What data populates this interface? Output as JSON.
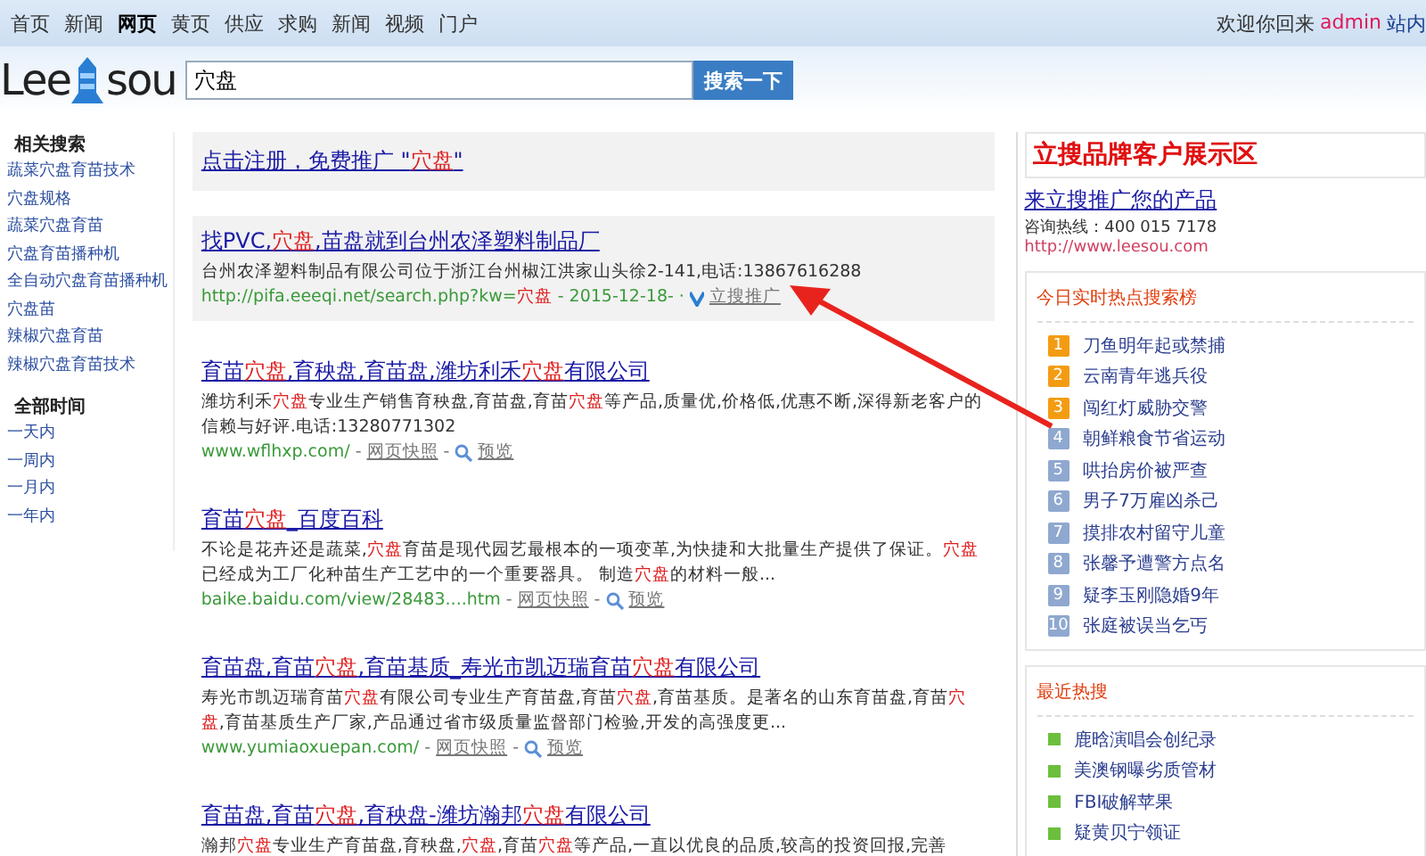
{
  "nav": {
    "items": [
      {
        "label": "首页",
        "selected": false
      },
      {
        "label": "新闻",
        "selected": false
      },
      {
        "label": "网页",
        "selected": true
      },
      {
        "label": "黄页",
        "selected": false
      },
      {
        "label": "供应",
        "selected": false
      },
      {
        "label": "求购",
        "selected": false
      },
      {
        "label": "新闻",
        "selected": false
      },
      {
        "label": "视频",
        "selected": false
      },
      {
        "label": "门户",
        "selected": false
      }
    ],
    "welcome": "欢迎你回来",
    "user": "admin",
    "site_link": "站内"
  },
  "logo": {
    "left": "Lee",
    "right": "sou"
  },
  "search": {
    "value": "穴盘",
    "button": "搜索一下"
  },
  "sidebar": [
    {
      "heading": "相关搜索",
      "items": [
        "蔬菜穴盘育苗技术",
        "穴盘规格",
        "蔬菜穴盘育苗",
        "穴盘育苗播种机",
        "全自动穴盘育苗播种机",
        "穴盘苗",
        "辣椒穴盘育苗",
        "辣椒穴盘育苗技术"
      ]
    },
    {
      "heading": "全部时间",
      "items": [
        "一天内",
        "一周内",
        "一月内",
        "一年内"
      ]
    }
  ],
  "promo": [
    {
      "t": "点击注册，免费推广 \"",
      "hl": false
    },
    {
      "t": "穴盘",
      "hl": true
    },
    {
      "t": "\"",
      "hl": false
    }
  ],
  "results": [
    {
      "sponsored": true,
      "title": [
        {
          "t": "找PVC,",
          "hl": false
        },
        {
          "t": "穴盘",
          "hl": true
        },
        {
          "t": ",苗盘就到台州农泽塑料制品厂",
          "hl": false
        }
      ],
      "desc": [
        {
          "t": "台州农泽塑料制品有限公司位于浙江台州椒江洪家山头徐2-141,电话:13867616288",
          "hl": false
        }
      ],
      "url": [
        {
          "t": "http://pifa.eeeqi.net/search.php?kw=",
          "hl": false
        },
        {
          "t": "穴盘",
          "hl": true
        },
        {
          "t": " - 2015-12-18- · ",
          "hl": false
        }
      ],
      "ad_label": "立搜推广"
    },
    {
      "sponsored": false,
      "title": [
        {
          "t": "育苗",
          "hl": false
        },
        {
          "t": "穴盘",
          "hl": true
        },
        {
          "t": ",育秧盘,育苗盘,潍坊利禾",
          "hl": false
        },
        {
          "t": "穴盘",
          "hl": true
        },
        {
          "t": "有限公司",
          "hl": false
        }
      ],
      "desc": [
        {
          "t": "潍坊利禾",
          "hl": false
        },
        {
          "t": "穴盘",
          "hl": true
        },
        {
          "t": "专业生产销售育秧盘,育苗盘,育苗",
          "hl": false
        },
        {
          "t": "穴盘",
          "hl": true
        },
        {
          "t": "等产品,质量优,价格低,优惠不断,深得新老客户的信赖与好评.电话:13280771302",
          "hl": false
        }
      ],
      "url": [
        {
          "t": "www.wflhxp.com/",
          "hl": false
        }
      ],
      "separator": "-",
      "snapshot": "网页快照",
      "preview": "预览"
    },
    {
      "sponsored": false,
      "title": [
        {
          "t": "育苗",
          "hl": false
        },
        {
          "t": "穴盘",
          "hl": true
        },
        {
          "t": "_百度百科",
          "hl": false
        }
      ],
      "desc": [
        {
          "t": "不论是花卉还是蔬菜,",
          "hl": false
        },
        {
          "t": "穴盘",
          "hl": true
        },
        {
          "t": "育苗是现代园艺最根本的一项变革,为快捷和大批量生产提供了保证。",
          "hl": false
        },
        {
          "t": "穴盘",
          "hl": true
        },
        {
          "t": "已经成为工厂化种苗生产工艺中的一个重要器具。 制造",
          "hl": false
        },
        {
          "t": "穴盘",
          "hl": true
        },
        {
          "t": "的材料一般...",
          "hl": false
        }
      ],
      "url": [
        {
          "t": "baike.baidu.com/view/28483....htm",
          "hl": false
        }
      ],
      "separator": "-",
      "snapshot": "网页快照",
      "preview": "预览"
    },
    {
      "sponsored": false,
      "title": [
        {
          "t": "育苗盘,育苗",
          "hl": false
        },
        {
          "t": "穴盘",
          "hl": true
        },
        {
          "t": ",育苗基质_寿光市凯迈瑞育苗",
          "hl": false
        },
        {
          "t": "穴盘",
          "hl": true
        },
        {
          "t": "有限公司",
          "hl": false
        }
      ],
      "desc": [
        {
          "t": "寿光市凯迈瑞育苗",
          "hl": false
        },
        {
          "t": "穴盘",
          "hl": true
        },
        {
          "t": "有限公司专业生产育苗盘,育苗",
          "hl": false
        },
        {
          "t": "穴盘",
          "hl": true
        },
        {
          "t": ",育苗基质。是著名的山东育苗盘,育苗",
          "hl": false
        },
        {
          "t": "穴盘",
          "hl": true
        },
        {
          "t": ",育苗基质生产厂家,产品通过省市级质量监督部门检验,开发的高强度更...",
          "hl": false
        }
      ],
      "url": [
        {
          "t": "www.yumiaoxuepan.com/",
          "hl": false
        }
      ],
      "separator": "-",
      "snapshot": "网页快照",
      "preview": "预览"
    },
    {
      "sponsored": false,
      "title": [
        {
          "t": "育苗盘,育苗",
          "hl": false
        },
        {
          "t": "穴盘",
          "hl": true
        },
        {
          "t": ",育秧盘-潍坊瀚邦",
          "hl": false
        },
        {
          "t": "穴盘",
          "hl": true
        },
        {
          "t": "有限公司",
          "hl": false
        }
      ],
      "desc": [
        {
          "t": "瀚邦",
          "hl": false
        },
        {
          "t": "穴盘",
          "hl": true
        },
        {
          "t": "专业生产育苗盘,育秧盘,",
          "hl": false
        },
        {
          "t": "穴盘",
          "hl": true
        },
        {
          "t": ",育苗",
          "hl": false
        },
        {
          "t": "穴盘",
          "hl": true
        },
        {
          "t": "等产品,一直以优良的品质,较高的投资回报,完善",
          "hl": false
        }
      ]
    }
  ],
  "brand": {
    "title": "立搜品牌客户展示区",
    "link": "来立搜推广您的产品",
    "hotline": "咨询热线：400 015 7178",
    "url": "http://www.leesou.com"
  },
  "hot_today": {
    "title": "今日实时热点搜索榜",
    "items": [
      {
        "rank": "1",
        "text": "刀鱼明年起或禁捕",
        "color": "#f39c12"
      },
      {
        "rank": "2",
        "text": "云南青年逃兵役",
        "color": "#f39c12"
      },
      {
        "rank": "3",
        "text": "闯红灯威胁交警",
        "color": "#f39c12"
      },
      {
        "rank": "4",
        "text": "朝鲜粮食节省运动",
        "color": "#8fa8cf"
      },
      {
        "rank": "5",
        "text": "哄抬房价被严查",
        "color": "#8fa8cf"
      },
      {
        "rank": "6",
        "text": "男子7万雇凶杀己",
        "color": "#8fa8cf"
      },
      {
        "rank": "7",
        "text": "摸排农村留守儿童",
        "color": "#8fa8cf"
      },
      {
        "rank": "8",
        "text": "张馨予遭警方点名",
        "color": "#8fa8cf"
      },
      {
        "rank": "9",
        "text": "疑李玉刚隐婚9年",
        "color": "#8fa8cf"
      },
      {
        "rank": "10",
        "text": "张庭被误当乞丐",
        "color": "#8fa8cf"
      }
    ]
  },
  "hot_recent": {
    "title": "最近热搜",
    "items": [
      "鹿晗演唱会创纪录",
      "美澳钢曝劣质管材",
      "FBI破解苹果",
      "疑黄贝宁领证"
    ]
  }
}
